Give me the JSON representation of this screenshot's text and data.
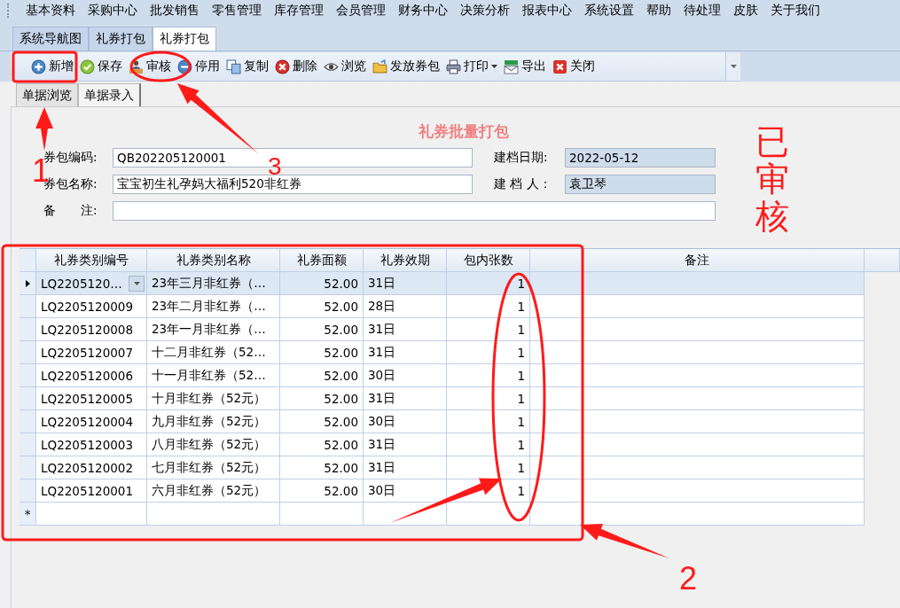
{
  "menu": [
    "基本资料",
    "采购中心",
    "批发销售",
    "零售管理",
    "库存管理",
    "会员管理",
    "财务中心",
    "决策分析",
    "报表中心",
    "系统设置",
    "帮助",
    "待处理",
    "皮肤",
    "关于我们"
  ],
  "tabs": [
    {
      "label": "系统导航图",
      "selected": false
    },
    {
      "label": "礼券打包",
      "selected": false
    },
    {
      "label": "礼券打包",
      "selected": true
    }
  ],
  "toolbar": [
    {
      "label": "新增",
      "kind": "plain"
    },
    {
      "label": "保存",
      "kind": "plain"
    },
    {
      "label": "审核",
      "kind": "plain"
    },
    {
      "label": "停用",
      "kind": "plain"
    },
    {
      "label": "复制",
      "kind": "plain"
    },
    {
      "label": "删除",
      "kind": "plain"
    },
    {
      "label": "浏览",
      "kind": "plain"
    },
    {
      "label": "发放券包",
      "kind": "plain"
    },
    {
      "label": "打印",
      "kind": "dropdown"
    },
    {
      "label": "导出",
      "kind": "plain"
    },
    {
      "label": "关闭",
      "kind": "plain"
    }
  ],
  "subtabs": [
    {
      "label": "单据浏览",
      "selected": false
    },
    {
      "label": "单据录入",
      "selected": true
    }
  ],
  "form": {
    "title": "礼券批量打包",
    "fields": [
      {
        "label": "券包编码:",
        "value": "QB202205120001",
        "readonly": false
      },
      {
        "label": "建档日期:",
        "value": "2022-05-12",
        "readonly": true
      },
      {
        "label": "券包名称:",
        "value": "宝宝初生礼孕妈大福利520非红券",
        "readonly": false
      },
      {
        "label": "建 档 人：",
        "value": "袁卫琴",
        "readonly": true
      },
      {
        "label": "备　　注:",
        "readonly": false
      }
    ]
  },
  "grid": {
    "columns": [
      "礼券类别编号",
      "礼券类别名称",
      "礼券面额",
      "礼券效期",
      "包内张数",
      "备注"
    ],
    "rows": [
      {
        "selected": true,
        "cells": [
          "LQ2205120…",
          "23年三月非红券（…",
          "52.00",
          "31日",
          "1"
        ]
      },
      {
        "selected": false,
        "cells": [
          "LQ2205120009",
          "23年二月非红券（…",
          "52.00",
          "28日",
          "1"
        ]
      },
      {
        "selected": false,
        "cells": [
          "LQ2205120008",
          "23年一月非红券（…",
          "52.00",
          "31日",
          "1"
        ]
      },
      {
        "selected": false,
        "cells": [
          "LQ2205120007",
          "十二月非红券（52…",
          "52.00",
          "31日",
          "1"
        ]
      },
      {
        "selected": false,
        "cells": [
          "LQ2205120006",
          "十一月非红券（52…",
          "52.00",
          "30日",
          "1"
        ]
      },
      {
        "selected": false,
        "cells": [
          "LQ2205120005",
          "十月非红券（52元）",
          "52.00",
          "31日",
          "1"
        ]
      },
      {
        "selected": false,
        "cells": [
          "LQ2205120004",
          "九月非红券（52元）",
          "52.00",
          "30日",
          "1"
        ]
      },
      {
        "selected": false,
        "cells": [
          "LQ2205120003",
          "八月非红券（52元）",
          "52.00",
          "31日",
          "1"
        ]
      },
      {
        "selected": false,
        "cells": [
          "LQ2205120002",
          "七月非红券（52元）",
          "52.00",
          "31日",
          "1"
        ]
      },
      {
        "selected": false,
        "cells": [
          "LQ2205120001",
          "六月非红券（52元）",
          "52.00",
          "30日",
          "1"
        ]
      }
    ],
    "new_row_marker": "*"
  },
  "annotations": {
    "numbers": [
      "1",
      "3",
      "2"
    ],
    "stamp": "已审核"
  }
}
